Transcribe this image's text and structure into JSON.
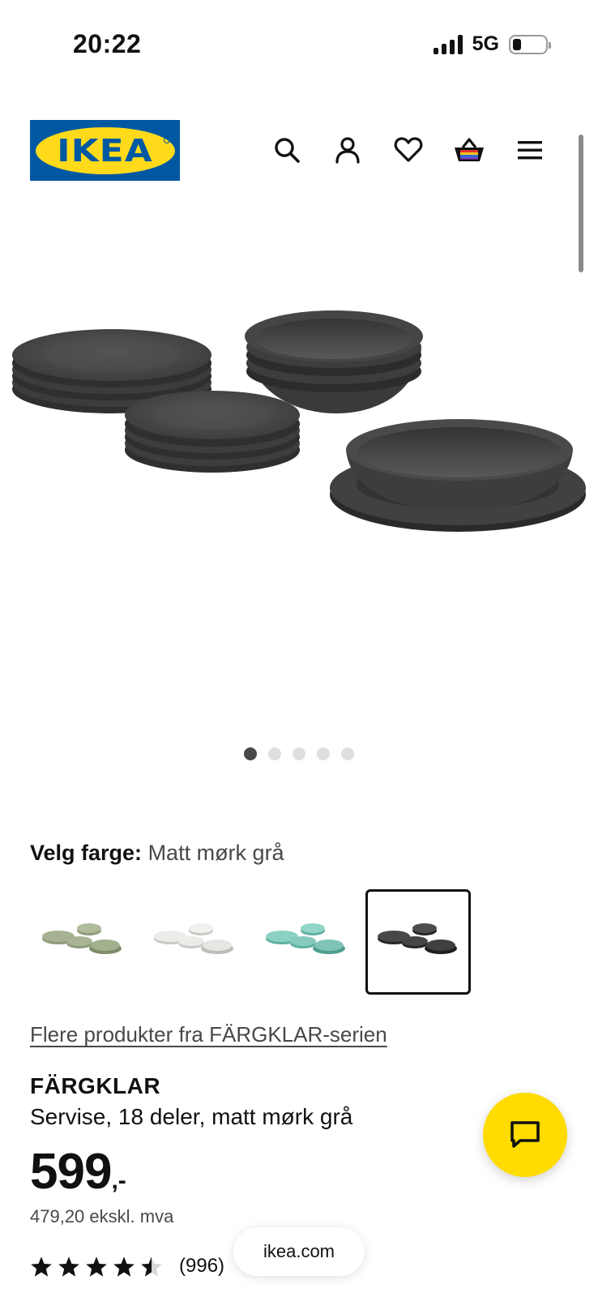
{
  "status_bar": {
    "time": "20:22",
    "network": "5G",
    "icons": [
      "signal-icon",
      "battery-icon"
    ]
  },
  "header": {
    "logo_text": "IKEA",
    "icons": [
      "search-icon",
      "account-icon",
      "heart-icon",
      "cart-icon",
      "menu-icon"
    ]
  },
  "gallery": {
    "dot_count": 5,
    "active_index": 0
  },
  "color_select": {
    "label": "Velg farge:",
    "value": "Matt mørk grå",
    "swatches": [
      {
        "name": "green",
        "color": "#a3b08e"
      },
      {
        "name": "white",
        "color": "#e6e6e3"
      },
      {
        "name": "turquoise",
        "color": "#86cbbd"
      },
      {
        "name": "dark-grey",
        "color": "#444444",
        "selected": true
      }
    ]
  },
  "series_link": "Flere produkter fra FÄRGKLAR-serien",
  "product": {
    "name": "FÄRGKLAR",
    "description": "Servise, 18 deler, matt mørk grå",
    "price": "599",
    "price_suffix": ",-",
    "price_ex_vat": "479,20 ekskl. mva",
    "rating": 4.5,
    "review_count": "(996)"
  },
  "browser": {
    "url": "ikea.com"
  },
  "colors": {
    "ikea_blue": "#0058a3",
    "ikea_yellow": "#ffda1a",
    "chat_yellow": "#ffdb00"
  }
}
